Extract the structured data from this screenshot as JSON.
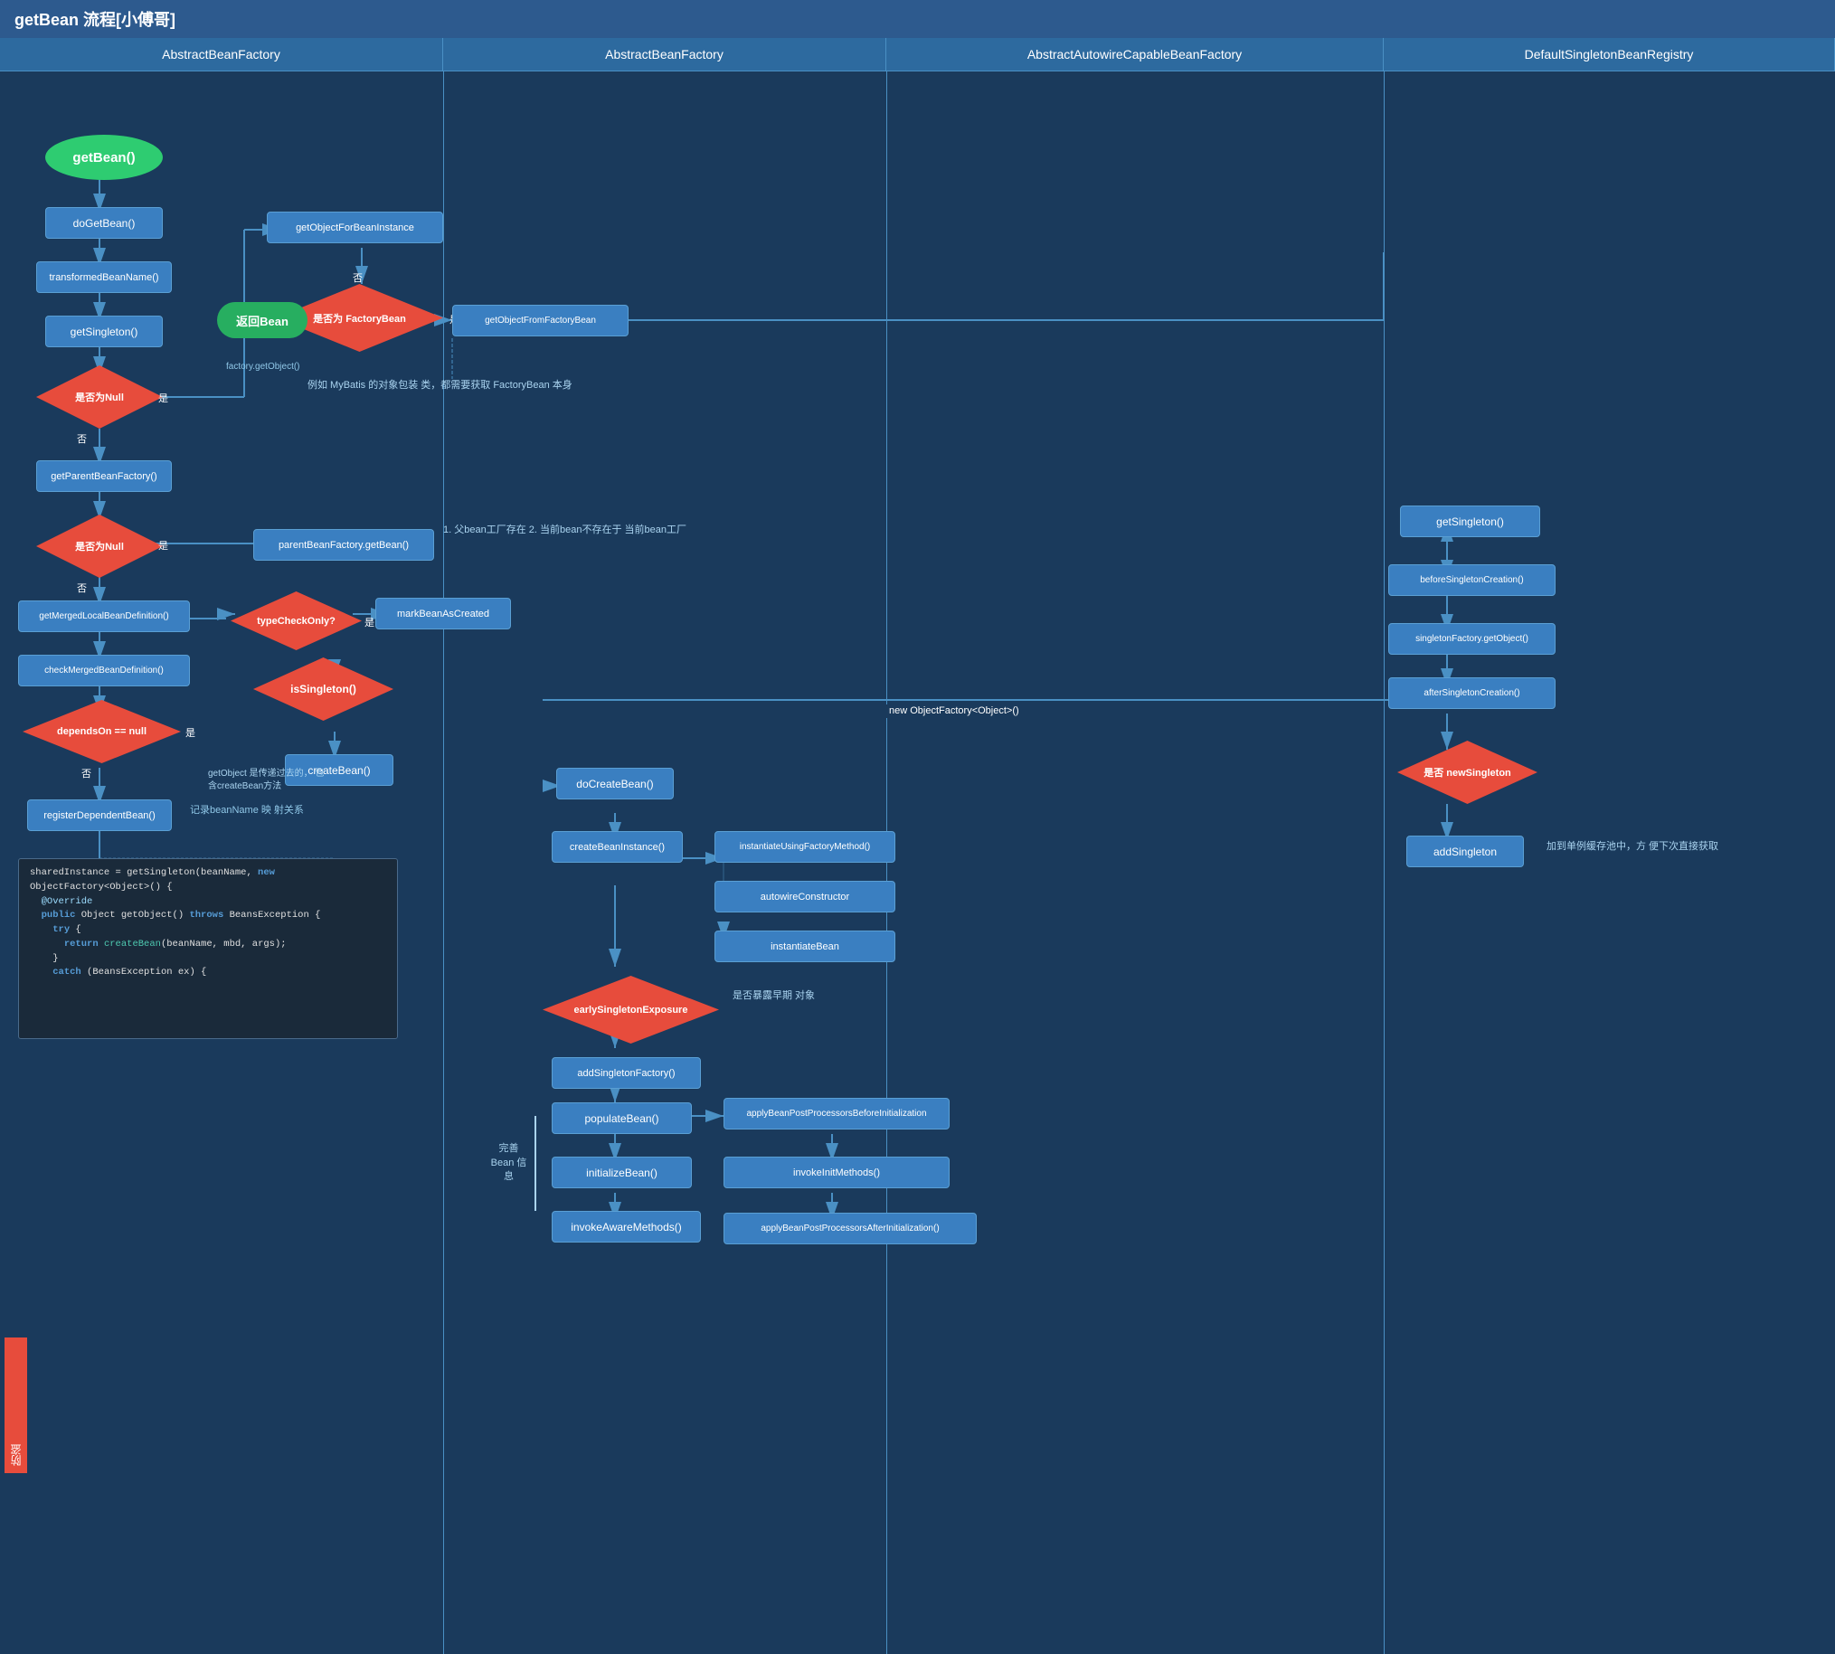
{
  "title": "getBean 流程[小傅哥]",
  "columns": {
    "col1": "AbstractBeanFactory",
    "col2": "AbstractBeanFactory",
    "col3": "AbstractAutowireCapableBeanFactory",
    "col4": "DefaultSingletonBeanRegistry"
  },
  "nodes": {
    "getBean": "getBean()",
    "doGetBean": "doGetBean()",
    "transformedBeanName": "transformedBeanName()",
    "getSingleton": "getSingleton()",
    "isNullCheck1": "是否为Null",
    "getParentBeanFactory": "getParentBeanFactory()",
    "isNullCheck2": "是否为Null",
    "getMergedLocalBeanDefinition": "getMergedLocalBeanDefinition()",
    "checkMergedBeanDefinition": "checkMergedBeanDefinition()",
    "dependsOn": "dependsOn == null",
    "registerDependentBean": "registerDependentBean()",
    "typeCheckOnly": "typeCheckOnly?",
    "markBeanAsCreated": "markBeanAsCreated",
    "isSingleton": "isSingleton()",
    "createBean": "createBean()",
    "getObjectForBeanInstance": "getObjectForBeanInstance",
    "isFactoryBean": "是否为\nFactoryBean",
    "returnBean": "返回Bean",
    "getObjectFromFactoryBean": "getObjectFromFactoryBean",
    "parentBeanFactoryGetBean": "parentBeanFactory.getBean()",
    "doCreateBean": "doCreateBean()",
    "createBeanInstance": "createBeanInstance()",
    "instantiateUsingFactoryMethod": "instantiateUsingFactoryMethod()",
    "autowireConstructor": "autowireConstructor",
    "instantiateBean": "instantiateBean",
    "earlySingletonExposure": "earlySingletonExposure",
    "addSingletonFactory": "addSingletonFactory()",
    "populateBean": "populateBean()",
    "initializeBean": "initializeBean()",
    "invokeAwareMethods": "invokeAwareMethods()",
    "applyBefore": "applyBeanPostProcessorsBeforeInitialization",
    "invokeInitMethods": "invokeInitMethods()",
    "applyAfter": "applyBeanPostProcessorsAfterInitialization()",
    "getSingleton2": "getSingleton()",
    "beforeSingletonCreation": "beforeSingletonCreation()",
    "singletonFactoryGetObject": "singletonFactory.getObject()",
    "afterSingletonCreation": "afterSingletonCreation()",
    "isNewSingleton": "是否\nnewSingleton",
    "addSingleton": "addSingleton"
  },
  "annotations": {
    "factoryGetObject": "factory.getObject()",
    "mybatisNote": "例如 MyBatis 的对象包装\n类，都需要获取\nFactoryBean 本身",
    "parentBeanNote": "1. 父bean工厂存在\n2. 当前bean不存在于\n当前bean工厂",
    "getObjectNote": "getObject 是传递过去的，\n包含createBean方法",
    "recordBeanNote": "记录beanName 映\n射关系",
    "earlySingletonNote": "是否暴露早期\n对象",
    "addSingletonNote": "加到单例缓存池中，方\n便下次直接获取",
    "completeBeanNote": "完善\nBean\n信息"
  },
  "labels": {
    "yes": "是",
    "no": "否",
    "new_object_factory": "new ObjectFactory<Object>()",
    "side_label": "防盗"
  }
}
